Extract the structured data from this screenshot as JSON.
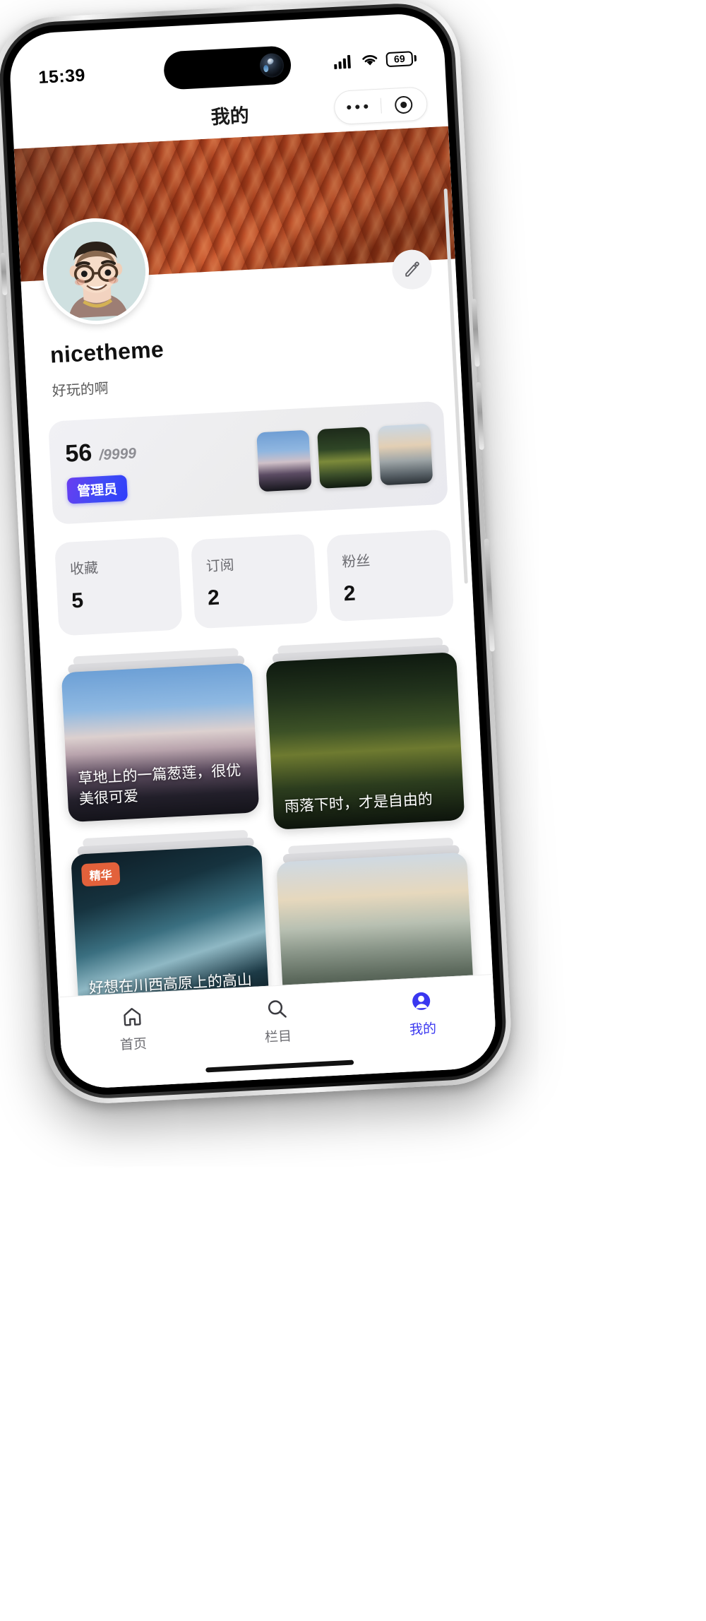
{
  "status_bar": {
    "time": "15:39",
    "signal_icon": "cellular-signal-icon",
    "wifi_icon": "wifi-icon",
    "battery_level": "69"
  },
  "nav": {
    "title": "我的",
    "capsule": {
      "more_icon": "more-dots-icon",
      "target_icon": "target-circle-icon"
    }
  },
  "profile": {
    "banner_alt": "canyon-banner-image",
    "avatar_alt": "user-avatar-memoji",
    "edit_icon": "pencil-edit-icon",
    "username": "nicetheme",
    "bio": "好玩的啊"
  },
  "level_card": {
    "current": "56",
    "max": "/9999",
    "badge": "管理员",
    "thumbs": [
      "mountain-thumb",
      "forest-thumb",
      "valley-thumb"
    ]
  },
  "stats": [
    {
      "label": "收藏",
      "value": "5"
    },
    {
      "label": "订阅",
      "value": "2"
    },
    {
      "label": "粉丝",
      "value": "2"
    }
  ],
  "posts": [
    {
      "title": "草地上的一篇葱莲，很优美很可爱",
      "image": "mountain-sunset-image",
      "tag": ""
    },
    {
      "title": "雨落下时，才是自由的",
      "image": "autumn-forest-image",
      "tag": ""
    },
    {
      "title": "好想在川西高原上的高山",
      "image": "glass-architecture-image",
      "tag": "精华"
    },
    {
      "title": "",
      "image": "hazy-hills-image",
      "tag": ""
    }
  ],
  "tabbar": [
    {
      "label": "首页",
      "icon": "home-icon",
      "active": false
    },
    {
      "label": "栏目",
      "icon": "search-icon",
      "active": false
    },
    {
      "label": "我的",
      "icon": "profile-avatar-icon",
      "active": true
    }
  ],
  "colors": {
    "accent": "#3a37f0",
    "badge_gradient_start": "#6a3df0",
    "badge_gradient_end": "#2f3dfb",
    "tag": "#e2613b",
    "card_bg": "#f0f0f3"
  }
}
